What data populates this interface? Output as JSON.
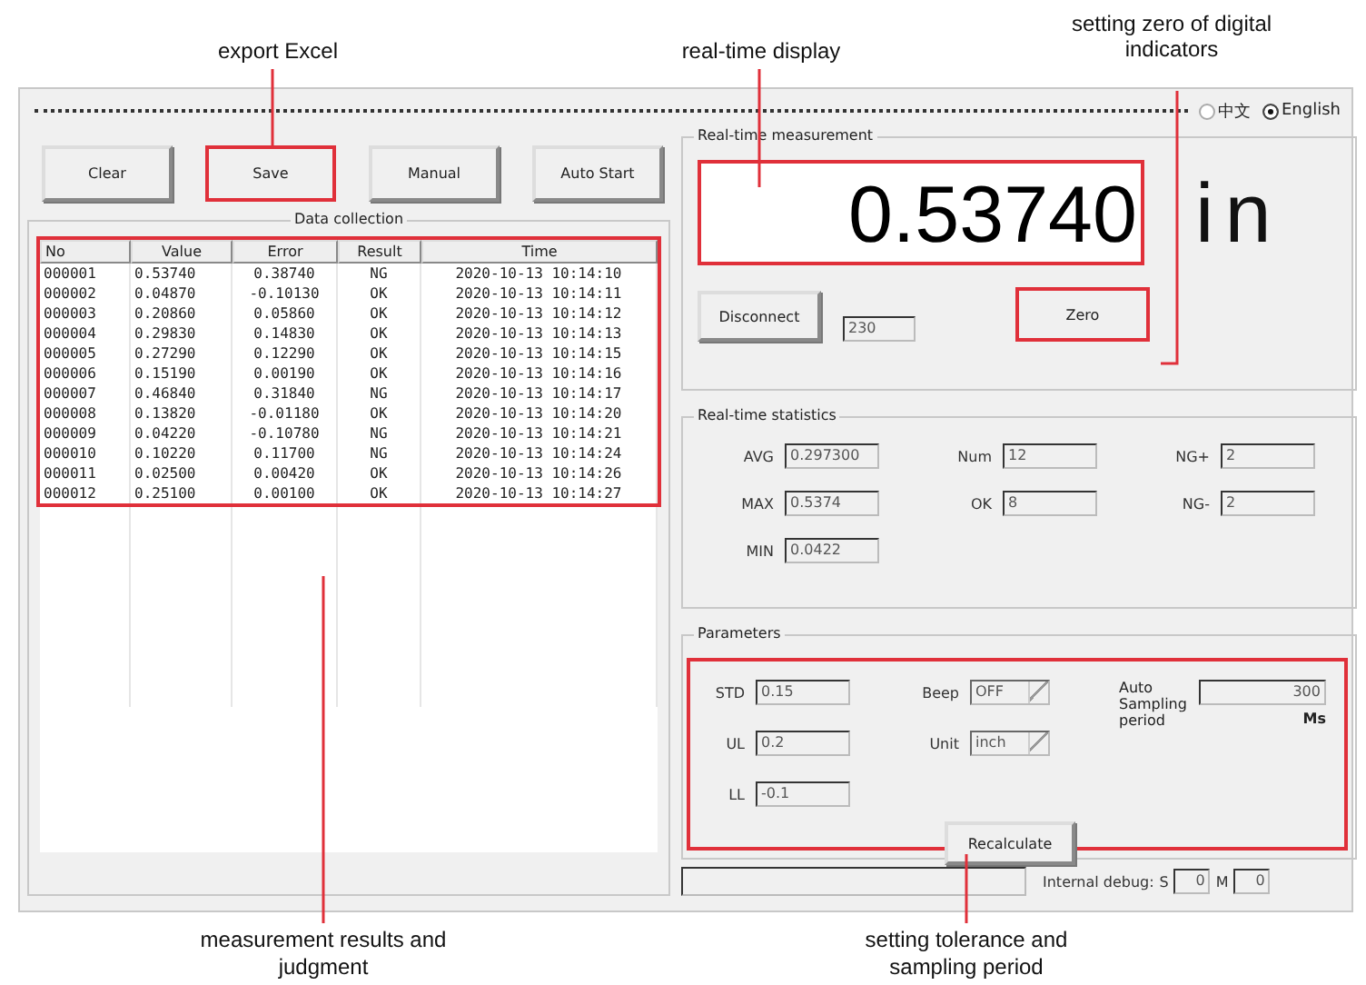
{
  "top_callouts": [
    "export Excel",
    "real-time display",
    "setting zero of digital indicators"
  ],
  "language_options": [
    {
      "label": "中文",
      "selected": false
    },
    {
      "label": "English",
      "selected": true
    }
  ],
  "toolbar_buttons": [
    {
      "label": "Clear",
      "highlighted": false
    },
    {
      "label": "Save",
      "highlighted": true
    },
    {
      "label": "Manual",
      "highlighted": false
    },
    {
      "label": "Auto Start",
      "highlighted": false
    }
  ],
  "data_collection": {
    "title": "Data collection",
    "highlighted": true,
    "columns": [
      "No",
      "Value",
      "Error",
      "Result",
      "Time"
    ],
    "rows": [
      [
        "000001",
        "0.53740",
        "0.38740",
        "NG",
        "2020-10-13 10:14:10"
      ],
      [
        "000002",
        "0.04870",
        "-0.10130",
        "OK",
        "2020-10-13 10:14:11"
      ],
      [
        "000003",
        "0.20860",
        "0.05860",
        "OK",
        "2020-10-13 10:14:12"
      ],
      [
        "000004",
        "0.29830",
        "0.14830",
        "OK",
        "2020-10-13 10:14:13"
      ],
      [
        "000005",
        "0.27290",
        "0.12290",
        "OK",
        "2020-10-13 10:14:15"
      ],
      [
        "000006",
        "0.15190",
        "0.00190",
        "OK",
        "2020-10-13 10:14:16"
      ],
      [
        "000007",
        "0.46840",
        "0.31840",
        "NG",
        "2020-10-13 10:14:17"
      ],
      [
        "000008",
        "0.13820",
        "-0.01180",
        "OK",
        "2020-10-13 10:14:20"
      ],
      [
        "000009",
        "0.04220",
        "-0.10780",
        "NG",
        "2020-10-13 10:14:21"
      ],
      [
        "000010",
        "0.10220",
        "0.11700",
        "NG",
        "2020-10-13 10:14:24"
      ],
      [
        "000011",
        "0.02500",
        "0.00420",
        "OK",
        "2020-10-13 10:14:26"
      ],
      [
        "000012",
        "0.25100",
        "0.00100",
        "OK",
        "2020-10-13 10:14:27"
      ]
    ]
  },
  "realtime": {
    "title": "Real-time measurement",
    "value": "0.53740",
    "unit": "in",
    "value_highlighted": true,
    "connect_button": "Disconnect",
    "port": "230",
    "zero_button": {
      "label": "Zero",
      "highlighted": true
    }
  },
  "statistics": {
    "title": "Real-time statistics",
    "fields": [
      {
        "label": "AVG",
        "value": "0.297300"
      },
      {
        "label": "Num",
        "value": "12"
      },
      {
        "label": "NG+",
        "value": "2"
      },
      {
        "label": "MAX",
        "value": "0.5374"
      },
      {
        "label": "OK",
        "value": "8"
      },
      {
        "label": "NG-",
        "value": "2"
      },
      {
        "label": "MIN",
        "value": "0.0422"
      }
    ]
  },
  "parameters": {
    "title": "Parameters",
    "highlighted": true,
    "fields": [
      {
        "label": "STD",
        "value": "0.15"
      },
      {
        "label": "UL",
        "value": "0.2"
      },
      {
        "label": "LL",
        "value": "-0.1"
      }
    ],
    "dropdowns": [
      {
        "label": "Beep",
        "value": "OFF"
      },
      {
        "label": "Unit",
        "value": "inch"
      }
    ],
    "sampling": {
      "label": "Auto Sampling period",
      "value": "300",
      "unit": "Ms"
    },
    "recalculate_button": "Recalculate"
  },
  "status": {
    "debug_label": "Internal debug:",
    "fields": [
      {
        "label": "S",
        "value": "0"
      },
      {
        "label": "M",
        "value": "0"
      }
    ]
  },
  "bottom_callouts": [
    "measurement results and judgment",
    "setting tolerance and sampling period"
  ]
}
